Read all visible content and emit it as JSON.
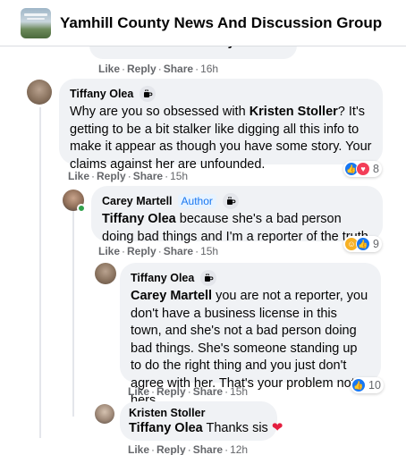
{
  "header": {
    "group_name": "Yamhill County News And Discussion Group"
  },
  "prev_comment": {
    "text_partial": "Nick Banta how that you mention it",
    "actions": {
      "like": "Like",
      "reply": "Reply",
      "share": "Share",
      "time": "16h"
    }
  },
  "comments": [
    {
      "author": "Tiffany Olea",
      "badge_icon": "coffee-cup-icon",
      "text_before": "Why are you so obsessed with ",
      "mention": "Kristen Stoller",
      "text_after": "? It's getting to be a bit stalker like digging all this info to make it appear as though you have some story. Your claims against her are unfounded.",
      "actions": {
        "like": "Like",
        "reply": "Reply",
        "share": "Share",
        "time": "15h"
      },
      "reactions": {
        "types": [
          "like",
          "love"
        ],
        "count": "8"
      }
    },
    {
      "author": "Carey Martell",
      "author_badge": "Author",
      "badge_icon": "coffee-cup-icon",
      "mention": "Tiffany Olea",
      "text_after": " because she's a bad person doing bad things and I'm a reporter of the truth",
      "actions": {
        "like": "Like",
        "reply": "Reply",
        "share": "Share",
        "time": "15h"
      },
      "reactions": {
        "types": [
          "haha",
          "like"
        ],
        "count": "9"
      }
    },
    {
      "author": "Tiffany Olea",
      "badge_icon": "coffee-cup-icon",
      "mention": "Carey Martell",
      "text_after": " you are not a reporter, you don't have a business license in this town, and she's not a bad person doing bad things. She's someone standing up to do the right thing and you just don't agree with her. That's your problem not hers.",
      "actions": {
        "like": "Like",
        "reply": "Reply",
        "share": "Share",
        "time": "15h"
      },
      "reactions": {
        "types": [
          "like"
        ],
        "count": "10"
      }
    },
    {
      "author": "Kristen Stoller",
      "mention": "Tiffany Olea",
      "text_after": " Thanks sis ",
      "emoji": "❤",
      "actions": {
        "like": "Like",
        "reply": "Reply",
        "share": "Share",
        "time": "12h"
      }
    }
  ],
  "colors": {
    "bubble": "#f0f2f5",
    "meta_text": "#65676b",
    "like_blue": "#1877f2",
    "love_red": "#f33e58",
    "haha_yellow": "#f7b125",
    "online_green": "#31a24c"
  }
}
